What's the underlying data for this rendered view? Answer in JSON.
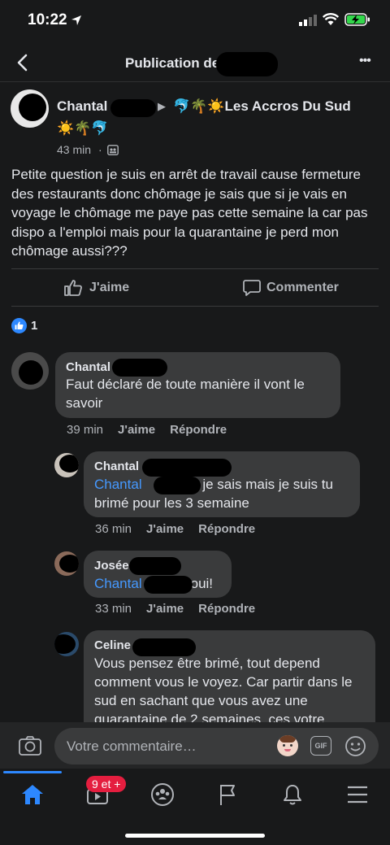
{
  "status": {
    "time": "10:22"
  },
  "header": {
    "title": "Publication de",
    "more": "•••"
  },
  "post": {
    "author": "Chantal",
    "arrow": "▶",
    "group": "🐬🌴☀️Les Accros Du Sud",
    "group_cont": "☀️🌴🐬",
    "time": "43 min",
    "text": "Petite question je suis en arrêt de travail cause fermeture des restaurants donc chômage je sais que si je vais en voyage le chômage me paye pas cette semaine la car pas dispo a l'emploi mais pour la quarantaine je perd mon chômage aussi???",
    "like_label": "J'aime",
    "comment_label": "Commenter",
    "reaction_count": "1"
  },
  "comments": [
    {
      "name": "Chantal",
      "text": "Faut déclaré de toute manière il vont le savoir",
      "time": "39 min",
      "like": "J'aime",
      "reply": "Répondre"
    },
    {
      "name": "Chantal",
      "mention": "Chantal",
      "text_a": " je sais mais je suis tu",
      "text_b": "brimé pour les 3 semaine",
      "time": "36 min",
      "like": "J'aime",
      "reply": "Répondre"
    },
    {
      "name": "Josée",
      "mention": "Chantal",
      "text": "oui!",
      "time": "33 min",
      "like": "J'aime",
      "reply": "Répondre"
    },
    {
      "name": "Celine",
      "text": "Vous pensez être brimé, tout depend comment vous le voyez. Car partir dans le sud  en sachant que vous avez une quarantaine de 2 semaines, ces votre"
    }
  ],
  "composer": {
    "placeholder": "Votre commentaire…",
    "gif": "GIF"
  },
  "tabs": {
    "badge": "9 et +"
  },
  "colors": {
    "accent": "#2d88ff",
    "mention": "#4599ff",
    "badge": "#e41e3f",
    "bubble": "#3a3b3c"
  }
}
